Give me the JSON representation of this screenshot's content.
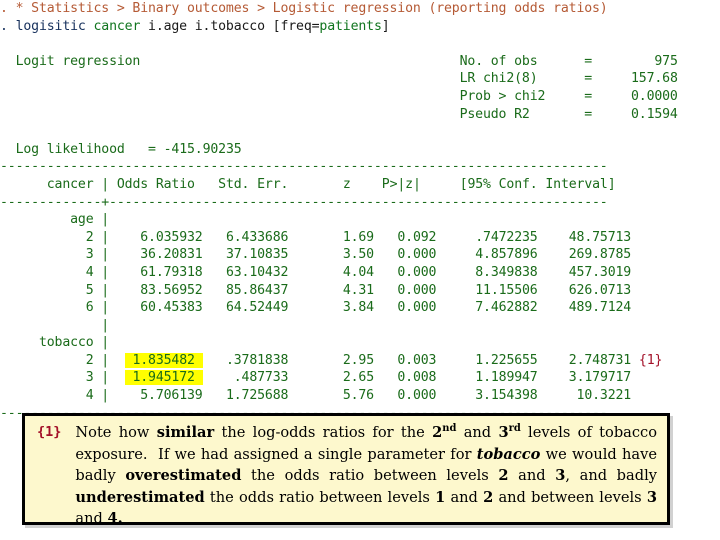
{
  "colors": {
    "output_green": "#1a6b1a",
    "comment_brown": "#b55a35",
    "command_navy": "#16305c",
    "keyword_green": "#11751f",
    "highlight_yellow": "#ffff00",
    "note_red": "#a31028",
    "callout_background": "#fdf8cd",
    "callout_border": "#000000"
  },
  "console": {
    "comment_line": {
      "prompt": ". ",
      "text": "* Statistics > Binary outcomes > Logistic regression (reporting odds ratios)"
    },
    "command_line": {
      "prompt": ". ",
      "command": "logisitic",
      "depvar": " cancer",
      "indepvars": " i.age i.tobacco ",
      "weight_open": "[freq=",
      "weight_var": "patients",
      "weight_close": "]"
    },
    "title": "Logit regression",
    "stats": [
      {
        "label": "No. of obs",
        "eq": "=",
        "value": "975"
      },
      {
        "label": "LR chi2(8)",
        "eq": "=",
        "value": "157.68"
      },
      {
        "label": "Prob > chi2",
        "eq": "=",
        "value": "0.0000"
      },
      {
        "label": "Pseudo R2",
        "eq": "=",
        "value": "0.1594"
      }
    ],
    "log_likelihood_label": "Log likelihood",
    "log_likelihood_eq": "=",
    "log_likelihood_value": "-415.90235",
    "rule_top": "------------------------------------------------------------------------------",
    "rule_mid": "-------------+----------------------------------------------------------------",
    "rule_bottom": "------------------------------------------------------------------------------",
    "table_header": {
      "depvar": "cancer",
      "bar": "|",
      "odds_ratio": "Odds Ratio",
      "std_err": "Std. Err.",
      "z": "z",
      "p": "P>|z|",
      "ci": "[95% Conf. Interval]"
    },
    "groups": [
      {
        "name": "age",
        "rows": [
          {
            "level": "2",
            "odds_ratio": "6.035932",
            "std_err": "6.433686",
            "z": "1.69",
            "p": "0.092",
            "ci_low": ".7472235",
            "ci_high": "48.75713",
            "highlight": false,
            "note": ""
          },
          {
            "level": "3",
            "odds_ratio": "36.20831",
            "std_err": "37.10835",
            "z": "3.50",
            "p": "0.000",
            "ci_low": "4.857896",
            "ci_high": "269.8785",
            "highlight": false,
            "note": ""
          },
          {
            "level": "4",
            "odds_ratio": "61.79318",
            "std_err": "63.10432",
            "z": "4.04",
            "p": "0.000",
            "ci_low": "8.349838",
            "ci_high": "457.3019",
            "highlight": false,
            "note": ""
          },
          {
            "level": "5",
            "odds_ratio": "83.56952",
            "std_err": "85.86437",
            "z": "4.31",
            "p": "0.000",
            "ci_low": "11.15506",
            "ci_high": "626.0713",
            "highlight": false,
            "note": ""
          },
          {
            "level": "6",
            "odds_ratio": "60.45383",
            "std_err": "64.52449",
            "z": "3.84",
            "p": "0.000",
            "ci_low": "7.462882",
            "ci_high": "489.7124",
            "highlight": false,
            "note": ""
          }
        ]
      },
      {
        "name": "tobacco",
        "rows": [
          {
            "level": "2",
            "odds_ratio": "1.835482",
            "std_err": ".3781838",
            "z": "2.95",
            "p": "0.003",
            "ci_low": "1.225655",
            "ci_high": "2.748731",
            "highlight": true,
            "note": "{1}"
          },
          {
            "level": "3",
            "odds_ratio": "1.945172",
            "std_err": ".487733",
            "z": "2.65",
            "p": "0.008",
            "ci_low": "1.189947",
            "ci_high": "3.179717",
            "highlight": true,
            "note": ""
          },
          {
            "level": "4",
            "odds_ratio": "5.706139",
            "std_err": "1.725688",
            "z": "5.76",
            "p": "0.000",
            "ci_low": "3.154398",
            "ci_high": "10.3221",
            "highlight": false,
            "note": ""
          }
        ]
      }
    ]
  },
  "callout": {
    "marker": "{1}",
    "text_plain": "Note how similar the log-odds ratios for the 2nd and 3rd levels of tobacco exposure.  If we had assigned a single parameter for tobacco we would have badly overestimated the odds ratio between levels 2 and 3, and badly underestimated the odds ratio between levels 1 and 2 and between levels 3 and 4."
  }
}
